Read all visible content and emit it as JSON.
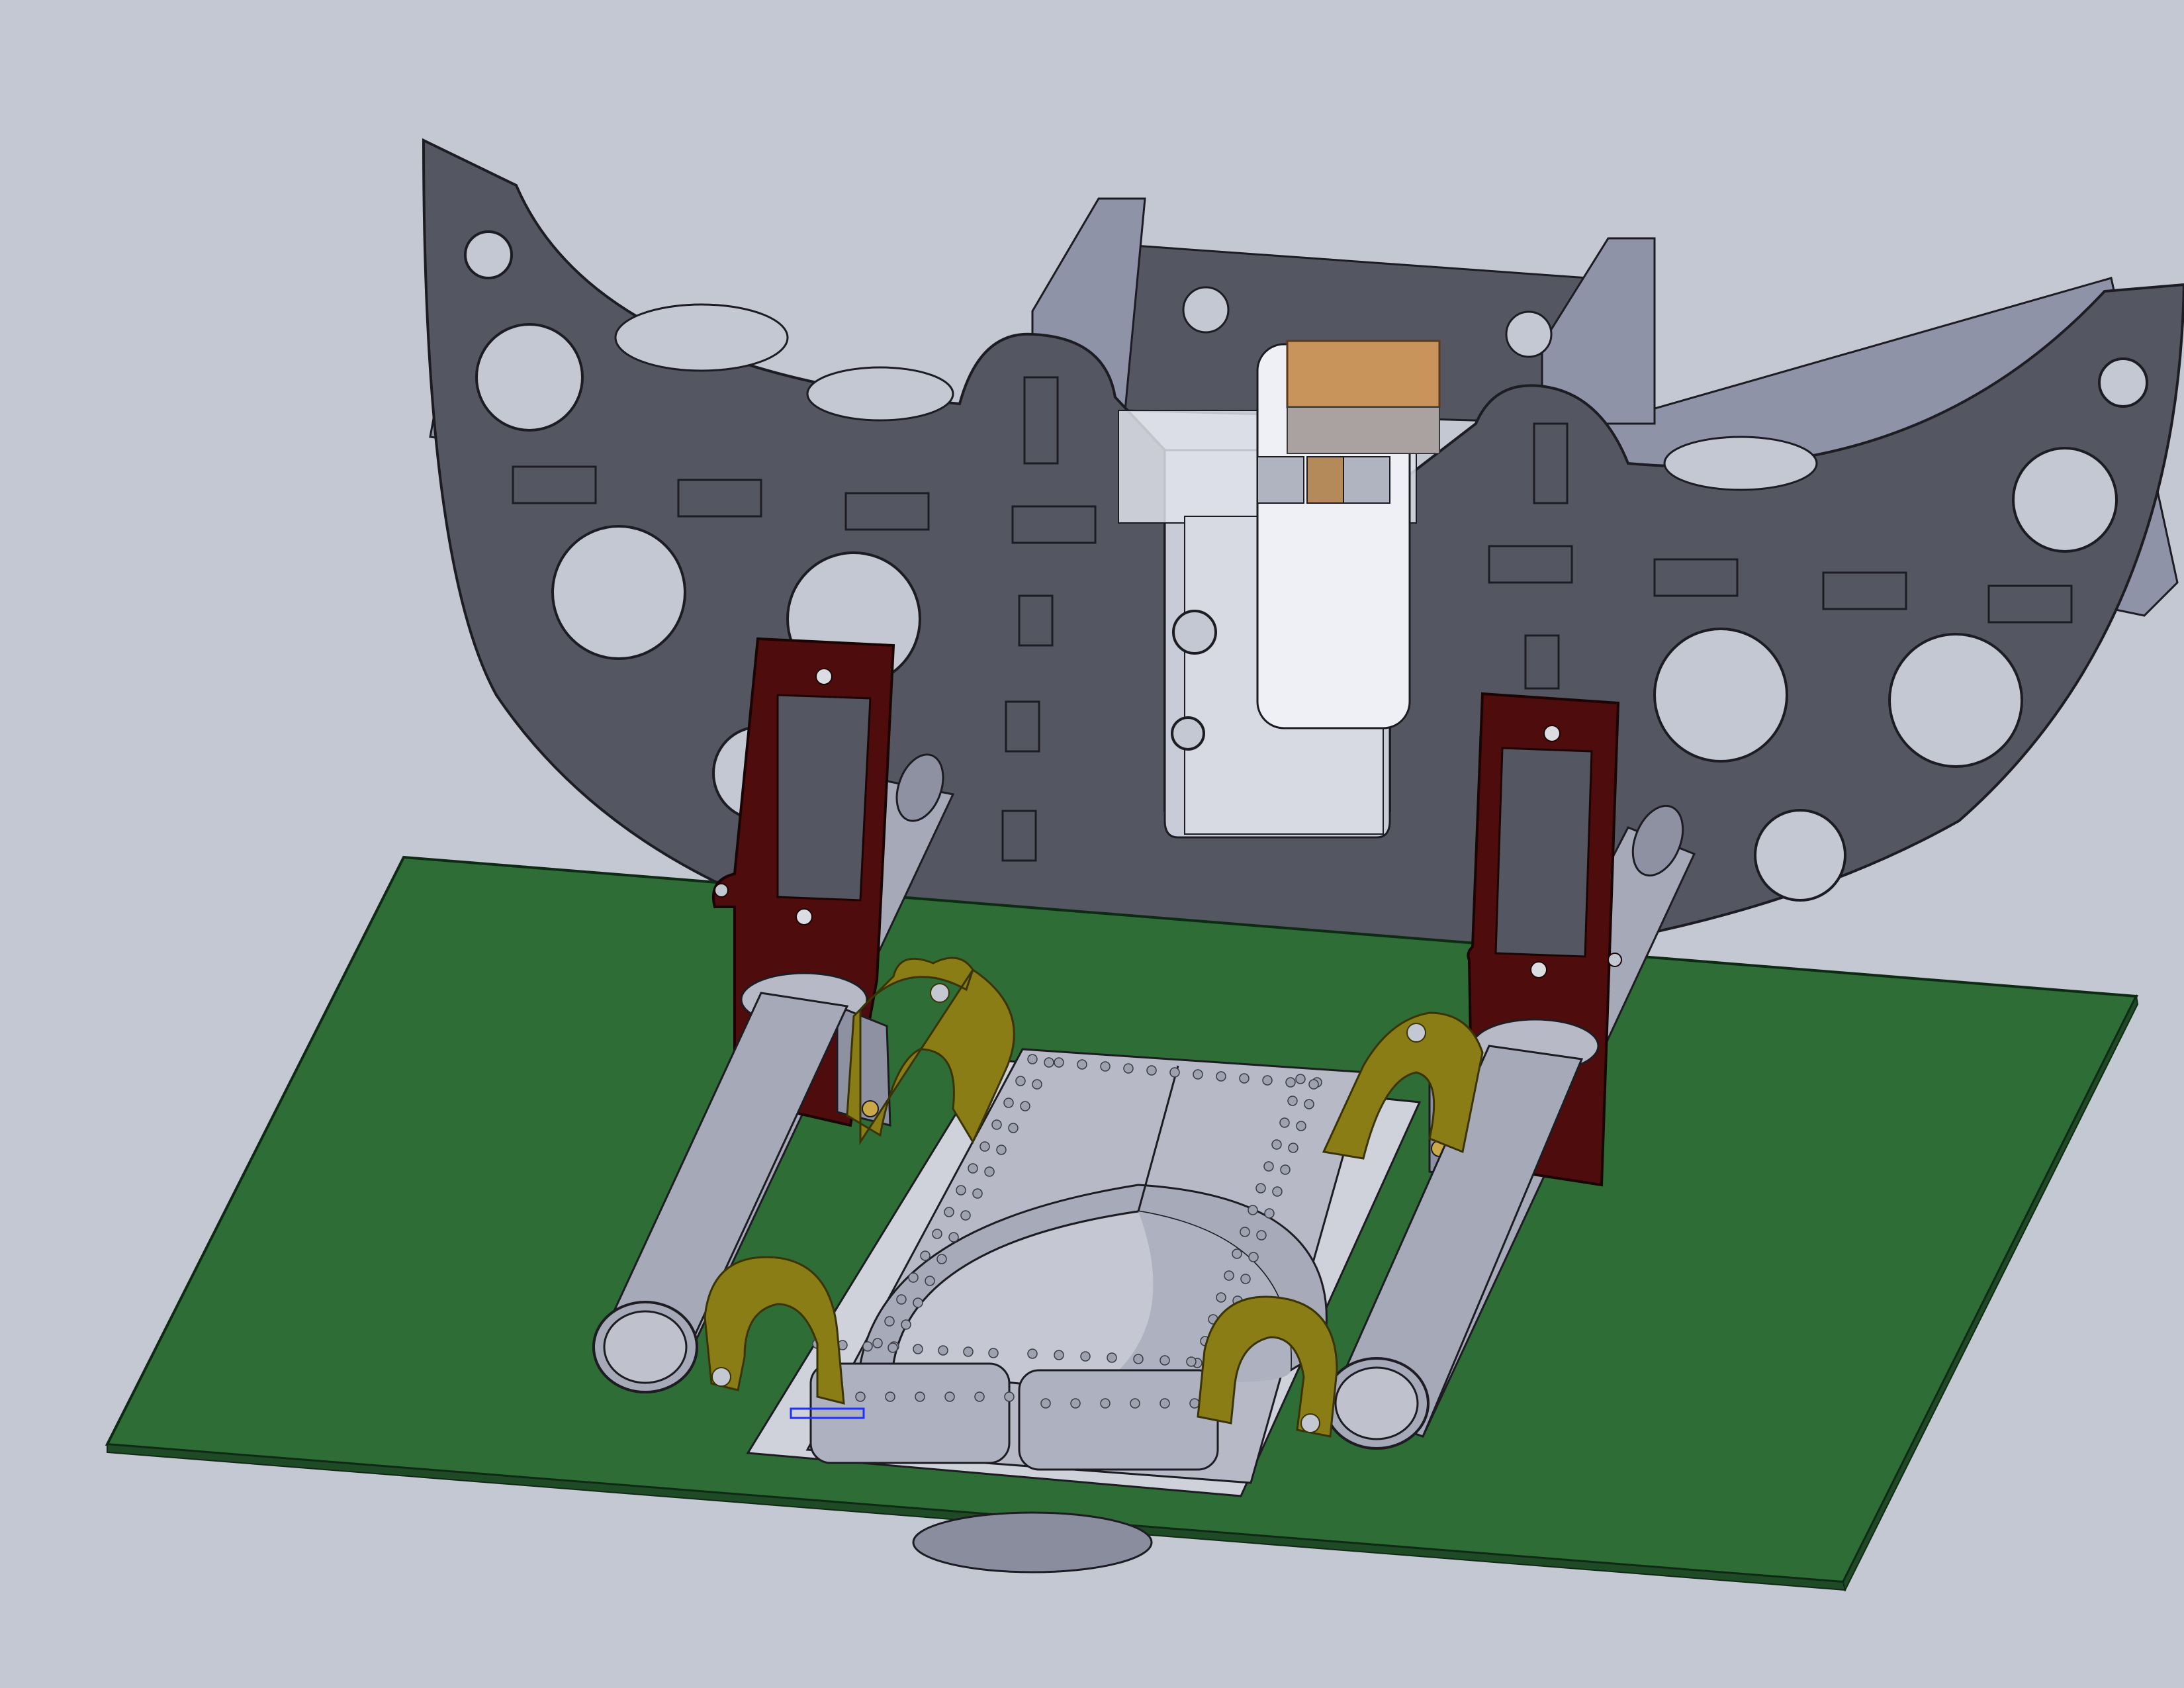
{
  "viewport": {
    "background": "#c3c8d2",
    "content": "cad-assembly-render"
  },
  "colors": {
    "frame_face": "#545661",
    "frame_edge": "#8e93a8",
    "frame_outline": "#1c1c22",
    "pcb_top": "#2f6d36",
    "pcb_edge": "#1f4a26",
    "bracket": "#4f0c0c",
    "clip": "#8a7d16",
    "tube": "#a6a9b8",
    "tube_dark": "#7e8192",
    "tray": "#b7b9c6",
    "tray_dark": "#8f92a2",
    "glass": "#dfe2ea",
    "connector": "#c9935c",
    "hole_bg": "#c3c8d2",
    "selection": "#2030ff"
  },
  "components": [
    {
      "name": "half-moon-frame",
      "material": "gray"
    },
    {
      "name": "pcb-board",
      "material": "green"
    },
    {
      "name": "left-bracket",
      "material": "maroon"
    },
    {
      "name": "right-bracket",
      "material": "maroon"
    },
    {
      "name": "left-tube",
      "material": "gray"
    },
    {
      "name": "right-tube",
      "material": "gray"
    },
    {
      "name": "clip",
      "material": "olive",
      "count": 4
    },
    {
      "name": "center-tray",
      "material": "light-gray"
    },
    {
      "name": "glass-window",
      "material": "transparent"
    }
  ]
}
